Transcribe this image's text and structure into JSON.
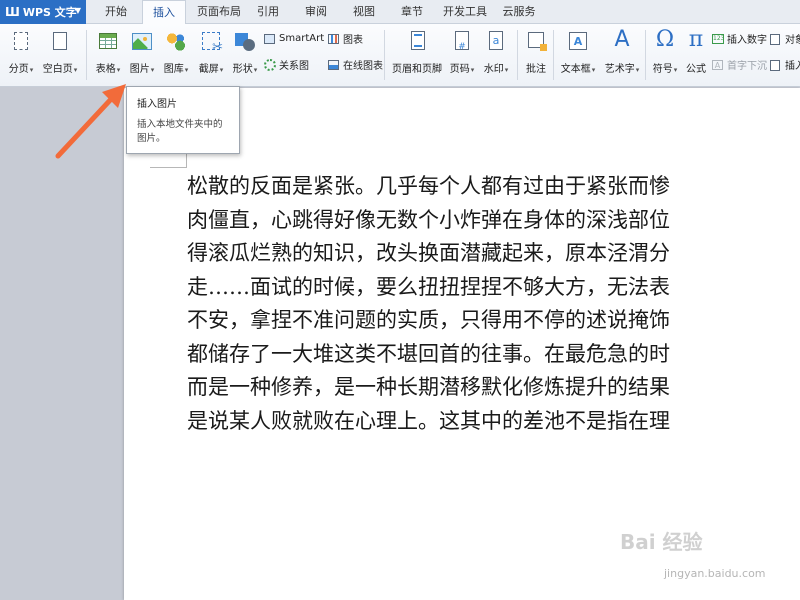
{
  "app": {
    "name": "WPS 文字"
  },
  "tabs": [
    "开始",
    "插入",
    "页面布局",
    "引用",
    "审阅",
    "视图",
    "章节",
    "开发工具",
    "云服务"
  ],
  "ribbon": {
    "page_break": "分页",
    "blank_page": "空白页",
    "table": "表格",
    "picture": "图片",
    "gallery": "图库",
    "screenshot": "截屏",
    "shape": "形状",
    "smartart": "SmartArt",
    "chart": "图表",
    "relation": "关系图",
    "online_chart": "在线图表",
    "header_footer": "页眉和页脚",
    "page_number": "页码",
    "watermark": "水印",
    "comment": "批注",
    "textbox": "文本框",
    "wordart": "艺术字",
    "symbol": "符号",
    "formula": "公式",
    "insert_number": "插入数字",
    "object": "对象",
    "drop_cap": "首字下沉",
    "insert_cut": "插入"
  },
  "tooltip": {
    "title": "插入图片",
    "desc": "插入本地文件夹中的图片。"
  },
  "document": {
    "lines": [
      "松散的反面是紧张。几乎每个人都有过由于紧张而惨",
      "肉僵直，心跳得好像无数个小炸弹在身体的深浅部位",
      "得滚瓜烂熟的知识，改头换面潜藏起来，原本泾渭分",
      "走……面试的时候，要么扭扭捏捏不够大方，无法表",
      "不安，拿捏不准问题的实质，只得用不停的述说掩饰",
      "都储存了一大堆这类不堪回首的往事。在最危急的时",
      "而是一种修养，是一种长期潜移默化修炼提升的结果",
      "是说某人败就败在心理上。这其中的差池不是指在理"
    ]
  },
  "watermark": {
    "logo": "Bai 经验",
    "url": "jingyan.baidu.com"
  },
  "colors": {
    "accent": "#2b6fc5",
    "arrow": "#f26b3a"
  }
}
